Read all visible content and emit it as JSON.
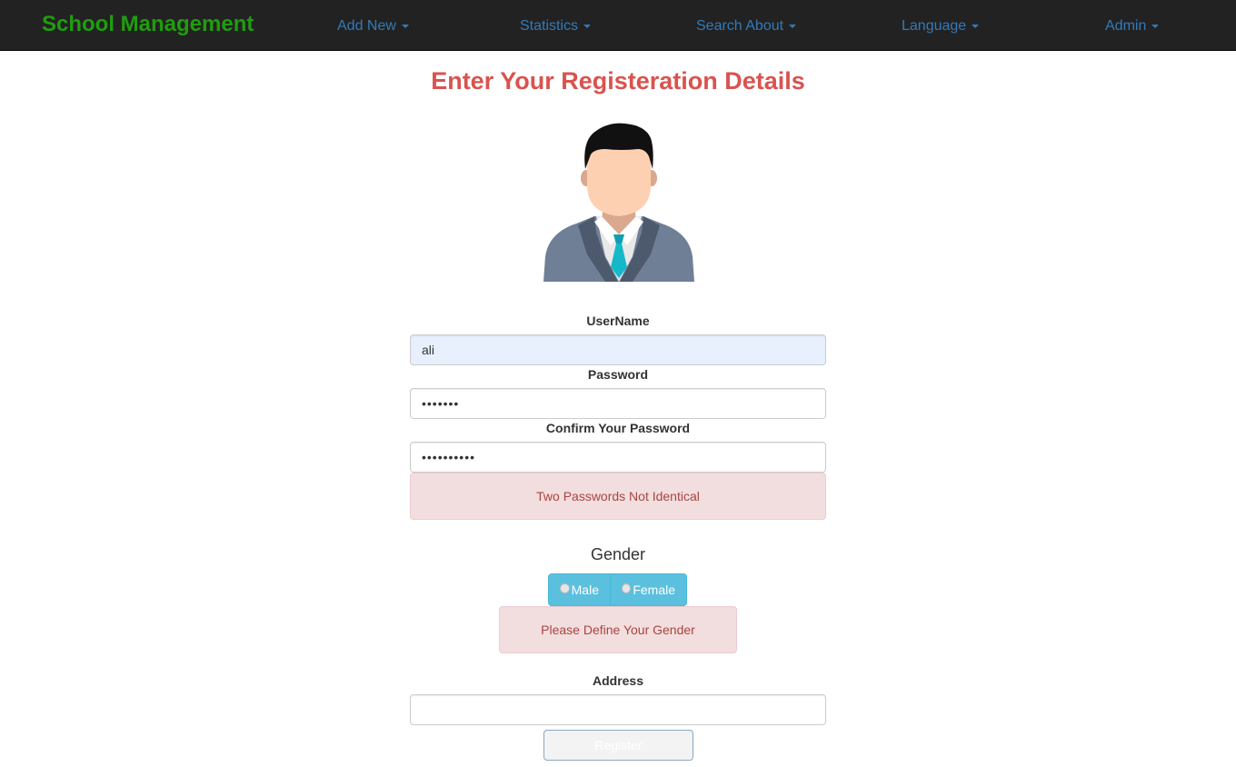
{
  "navbar": {
    "brand": "School Management",
    "items": [
      "Add New",
      "Statistics",
      "Search About",
      "Language",
      "Admin"
    ]
  },
  "page_title": "Enter Your Registeration Details",
  "form": {
    "username_label": "UserName",
    "username_value": "ali",
    "password_label": "Password",
    "password_value": "•••••••",
    "confirm_label": "Confirm Your Password",
    "confirm_value": "••••••••••",
    "password_error": "Two Passwords Not Identical",
    "gender_label": "Gender",
    "gender_options": [
      "Male",
      "Female"
    ],
    "gender_error": "Please Define Your Gender",
    "address_label": "Address",
    "address_value": "",
    "register_label": "Register"
  },
  "colors": {
    "brand": "#1f9d0f",
    "title": "#d9534f",
    "link": "#337ab7",
    "info_button": "#5bc0de",
    "danger_bg": "#f2dede",
    "danger_text": "#a94442"
  }
}
